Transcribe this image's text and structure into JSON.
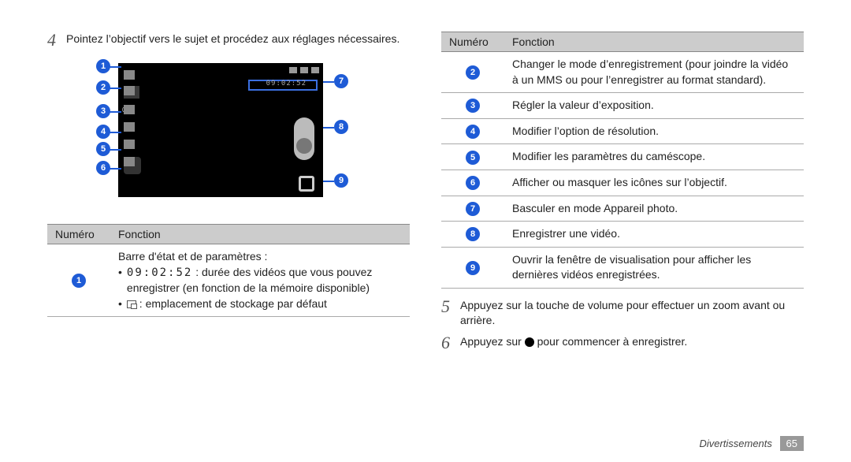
{
  "steps": {
    "s4_num": "4",
    "s4_text": "Pointez l’objectif vers le sujet et procédez aux réglages nécessaires.",
    "s5_num": "5",
    "s5_text": "Appuyez sur la touche de volume pour effectuer un zoom avant ou arrière.",
    "s6_num": "6",
    "s6_pre": "Appuyez sur ",
    "s6_post": " pour commencer à enregistrer."
  },
  "diagram": {
    "rec_time": "09:02:52",
    "exposure": "0.0"
  },
  "table_head": {
    "num": "Numéro",
    "fn": "Fonction"
  },
  "left_table": {
    "r1": {
      "n": "1",
      "l1": "Barre d'état et de paramètres :",
      "l2a": " : durée des vidéos que vous pouvez enregistrer (en fonction de la mémoire disponible)",
      "l2time": "09:02:52",
      "l3": " : emplacement de stockage par défaut"
    }
  },
  "right_table": {
    "r2": {
      "n": "2",
      "t": "Changer le mode d’enregistrement (pour joindre la vidéo à un MMS ou pour l’enregistrer au format standard)."
    },
    "r3": {
      "n": "3",
      "t": "Régler la valeur d’exposition."
    },
    "r4": {
      "n": "4",
      "t": "Modifier l’option de résolution."
    },
    "r5": {
      "n": "5",
      "t": "Modifier les paramètres du caméscope."
    },
    "r6": {
      "n": "6",
      "t": "Afficher ou masquer les icônes sur l’objectif."
    },
    "r7": {
      "n": "7",
      "t": "Basculer en mode Appareil photo."
    },
    "r8": {
      "n": "8",
      "t": "Enregistrer une vidéo."
    },
    "r9": {
      "n": "9",
      "t": "Ouvrir la fenêtre de visualisation pour afficher les dernières vidéos enregistrées."
    }
  },
  "footer": {
    "section": "Divertissements",
    "page": "65"
  }
}
